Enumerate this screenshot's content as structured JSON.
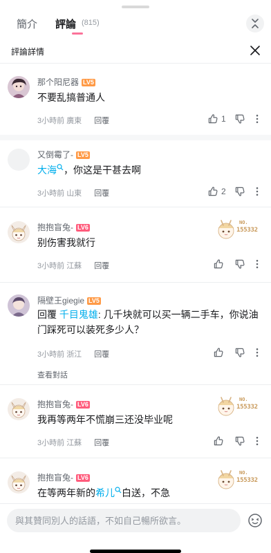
{
  "tabs": {
    "intro": "簡介",
    "comments": "評論",
    "count": "(815)"
  },
  "detail": {
    "title": "評論詳情"
  },
  "comments": [
    {
      "user": "那个阳尼器",
      "level": "LV5",
      "text": "不要乱搞普通人",
      "time": "3小時前",
      "location": "廣東",
      "reply": "回覆",
      "likes": "1"
    },
    {
      "user": "又倒霉了-",
      "level": "LV5",
      "mention": "大海",
      "text": "，你这是干甚去啊",
      "time": "3小時前",
      "location": "山東",
      "reply": "回覆",
      "likes": "2"
    },
    {
      "user": "抱抱盲兔-",
      "level": "LV6",
      "text": "别伤害我就行",
      "time": "3小時前",
      "location": "江蘇",
      "reply": "回覆",
      "badge_no": "NO.",
      "badge_num": "155332"
    },
    {
      "user": "隔壁王giegie",
      "level": "LV5",
      "reply_prefix": "回覆",
      "reply_to": "千目鬼雄",
      "text": ": 几千块就可以买一辆二手车，你说油门踩死可以装死多少人？",
      "time": "3小時前",
      "location": "浙江",
      "reply": "回覆",
      "view_conversation": "查看對話"
    },
    {
      "user": "抱抱盲兔-",
      "level": "LV6",
      "text": "我再等两年不慌崩三还没毕业呢",
      "time": "3小時前",
      "location": "江蘇",
      "reply": "回覆",
      "badge_no": "NO.",
      "badge_num": "155332"
    },
    {
      "user": "抱抱盲兔-",
      "level": "LV6",
      "text_before": "在等两年新的",
      "mention": "希儿",
      "text_after": "白送，不急",
      "badge_no": "NO.",
      "badge_num": "155332"
    }
  ],
  "input": {
    "placeholder": "與其贊同別人的話語，不如自己暢所欲言。"
  },
  "colors": {
    "accent_pink": "#fb7299",
    "link_blue": "#00aeec",
    "lv5": "#ff9a46",
    "lv6": "#ff5c7c"
  }
}
